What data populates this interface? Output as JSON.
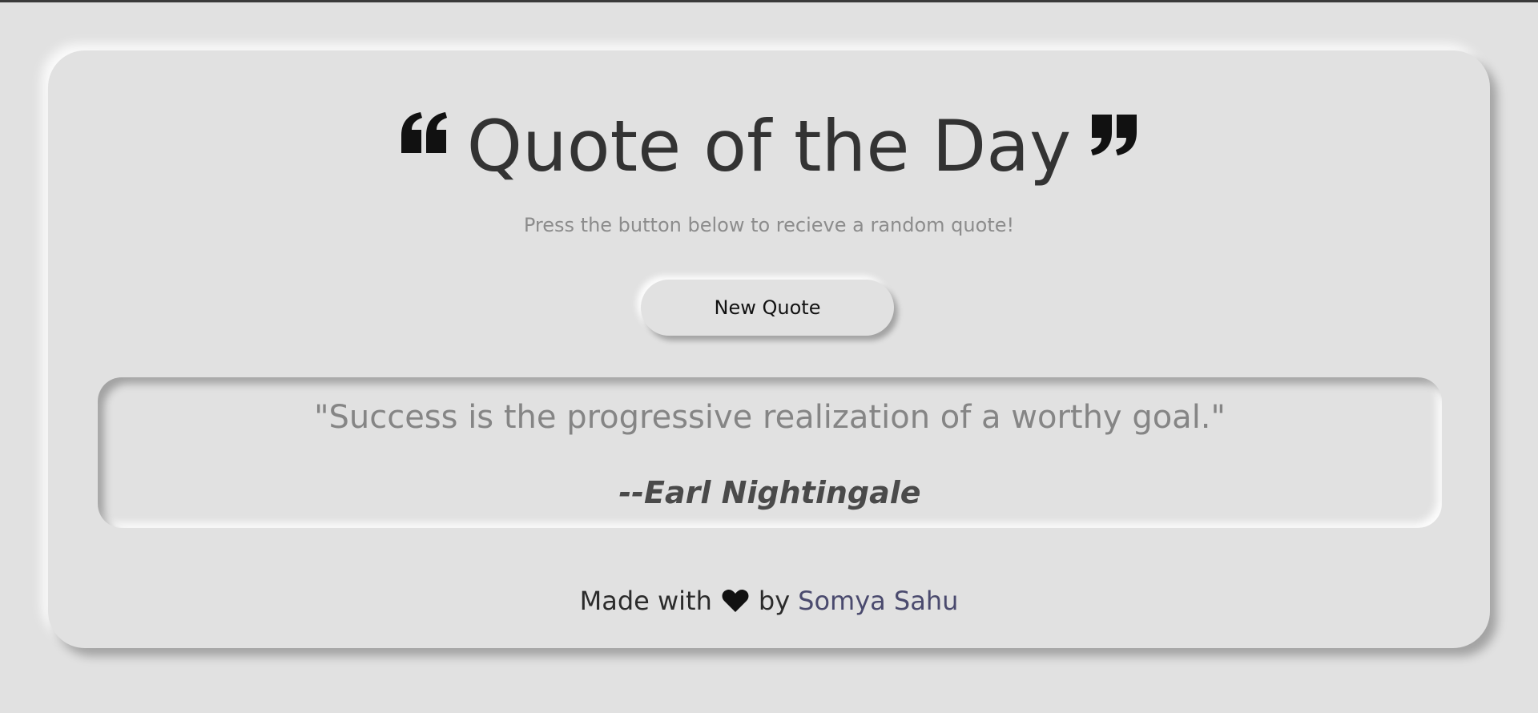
{
  "header": {
    "title": "Quote of the Day",
    "open_quote_icon": "quote-left-icon",
    "close_quote_icon": "quote-right-icon"
  },
  "subtitle": "Press the button below to recieve a random quote!",
  "button": {
    "label": "New Quote"
  },
  "quote": {
    "text": "\"Success is the progressive realization of a worthy goal.\"",
    "author": "--Earl Nightingale"
  },
  "footer": {
    "made_with": "Made with",
    "heart_icon": "heart-icon",
    "by": "by",
    "author_name": "Somya Sahu"
  },
  "colors": {
    "background": "#e1e1e1",
    "title": "#333333",
    "author_link": "#4a4a6e"
  }
}
